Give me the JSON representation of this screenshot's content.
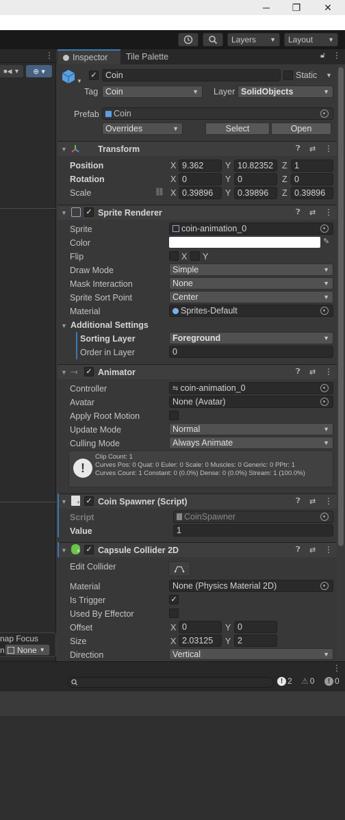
{
  "window": {
    "minimize": "─",
    "maximize": "❐",
    "close": "✕"
  },
  "toolbar": {
    "history_icon": "history-icon",
    "search_icon": "search-icon",
    "layers_label": "Layers",
    "layout_label": "Layout"
  },
  "tabs": {
    "inspector": "Inspector",
    "tile_palette": "Tile Palette"
  },
  "scene": {
    "map_focus_label": "nap Focus",
    "map_focus_value": "None",
    "map_focus_prefix": "n"
  },
  "object": {
    "name": "Coin",
    "static_label": "Static",
    "tag_label": "Tag",
    "tag_value": "Coin",
    "layer_label": "Layer",
    "layer_value": "SolidObjects",
    "prefab_label": "Prefab",
    "prefab_value": "Coin",
    "overrides_label": "Overrides",
    "select_label": "Select",
    "open_label": "Open"
  },
  "transform": {
    "title": "Transform",
    "position_label": "Position",
    "rotation_label": "Rotation",
    "scale_label": "Scale",
    "position": {
      "x": "9.362",
      "y": "10.82352",
      "z": "1"
    },
    "rotation": {
      "x": "0",
      "y": "0",
      "z": "0"
    },
    "scale": {
      "x": "0.39896",
      "y": "0.39896",
      "z": "0.39896"
    },
    "axis_x": "X",
    "axis_y": "Y",
    "axis_z": "Z"
  },
  "sprite_renderer": {
    "title": "Sprite Renderer",
    "sprite_label": "Sprite",
    "sprite_value": "coin-animation_0",
    "color_label": "Color",
    "color_value": "#ffffff",
    "flip_label": "Flip",
    "flip_x": "X",
    "flip_y": "Y",
    "draw_mode_label": "Draw Mode",
    "draw_mode_value": "Simple",
    "mask_label": "Mask Interaction",
    "mask_value": "None",
    "sort_point_label": "Sprite Sort Point",
    "sort_point_value": "Center",
    "material_label": "Material",
    "material_value": "Sprites-Default",
    "additional_label": "Additional Settings",
    "sorting_layer_label": "Sorting Layer",
    "sorting_layer_value": "Foreground",
    "order_label": "Order in Layer",
    "order_value": "0"
  },
  "animator": {
    "title": "Animator",
    "controller_label": "Controller",
    "controller_value": "coin-animation_0",
    "avatar_label": "Avatar",
    "avatar_value": "None (Avatar)",
    "root_motion_label": "Apply Root Motion",
    "update_mode_label": "Update Mode",
    "update_mode_value": "Normal",
    "culling_label": "Culling Mode",
    "culling_value": "Always Animate",
    "info_line1": "Clip Count: 1",
    "info_line2": "Curves Pos: 0 Quat: 0 Euler: 0 Scale: 0 Muscles: 0 Generic: 0 PPtr: 1",
    "info_line3": "Curves Count: 1 Constant: 0 (0.0%) Dense: 0 (0.0%) Stream: 1 (100.0%)"
  },
  "coin_spawner": {
    "title": "Coin Spawner (Script)",
    "script_label": "Script",
    "script_value": "CoinSpawner",
    "value_label": "Value",
    "value_value": "1"
  },
  "collider": {
    "title": "Capsule Collider 2D",
    "edit_label": "Edit Collider",
    "material_label": "Material",
    "material_value": "None (Physics Material 2D)",
    "trigger_label": "Is Trigger",
    "effector_label": "Used By Effector",
    "offset_label": "Offset",
    "offset_x": "0",
    "offset_y": "0",
    "size_label": "Size",
    "size_x": "2.03125",
    "size_y": "2",
    "direction_label": "Direction",
    "direction_value": "Vertical"
  },
  "console": {
    "errors": "2",
    "warnings": "0",
    "messages": "0"
  },
  "colors": {
    "accent": "#3a79bb",
    "panel": "#383838",
    "header": "#3e3e3e",
    "field": "#2a2a2a"
  }
}
